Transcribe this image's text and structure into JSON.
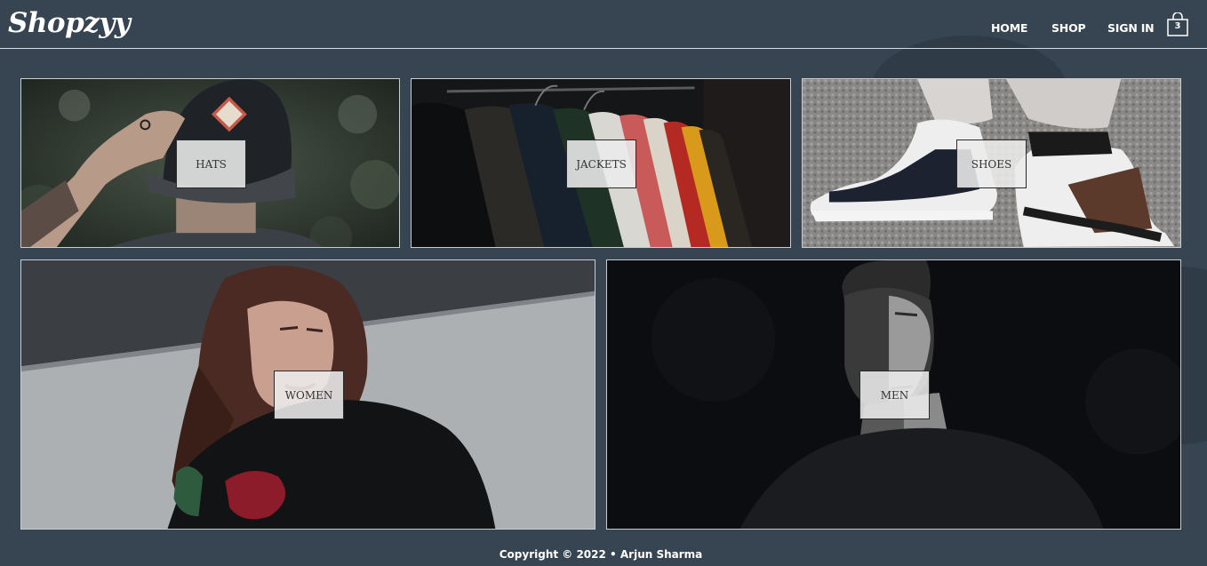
{
  "brand": {
    "logo": "Shopzyy"
  },
  "nav": {
    "home": "HOME",
    "shop": "SHOP",
    "sign_in": "SIGN IN",
    "cart_count": "3"
  },
  "categories": [
    {
      "label": "HATS"
    },
    {
      "label": "JACKETS"
    },
    {
      "label": "SHOES"
    },
    {
      "label": "WOMEN"
    },
    {
      "label": "MEN"
    }
  ],
  "footer": {
    "text": "Copyright © 2022 • Arjun Sharma"
  },
  "colors": {
    "background": "#374451",
    "header_rule": "#d6dbe0",
    "label_bg": "#ececec"
  },
  "icons": {
    "cart": "shopping-bag-icon"
  }
}
